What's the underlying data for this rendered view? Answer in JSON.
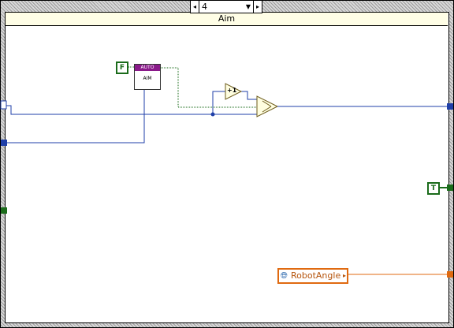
{
  "case_structure": {
    "selector_value": "4",
    "selector_arrow_left": "◂",
    "selector_arrow_right": "▸",
    "selector_dropdown": "▼",
    "title": "Aim"
  },
  "constants": {
    "false_label": "F",
    "true_label": "T"
  },
  "subvi": {
    "banner": "AUTO",
    "label": "AIM"
  },
  "increment": {
    "label": "+1"
  },
  "local_variable": {
    "icon": "globe-icon",
    "label": "RobotAngle",
    "arrow": "▸"
  },
  "colors": {
    "numeric_wire": "#1f3fa8",
    "boolean_wire": "#1a6b1a",
    "string_wire": "#e06a10",
    "case_title_bg": "#fffee6",
    "subvi_banner": "#8a1a8a"
  }
}
